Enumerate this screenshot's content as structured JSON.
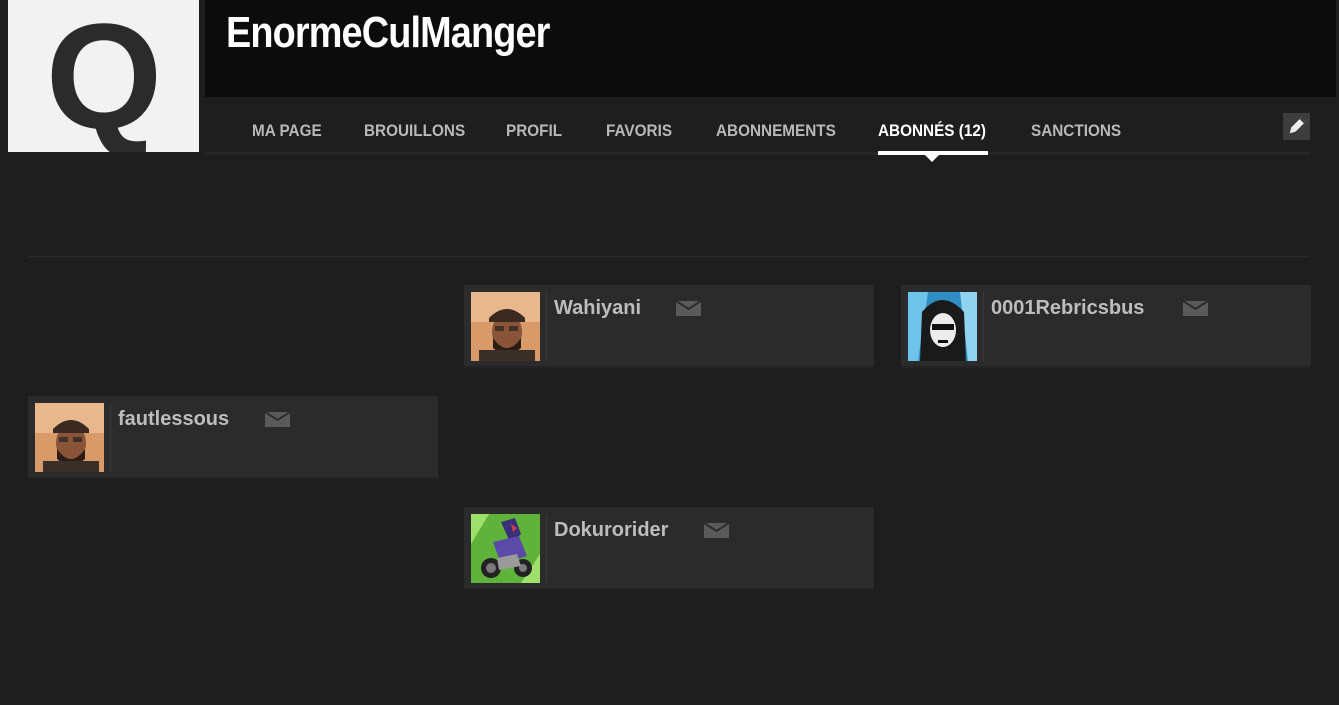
{
  "profile": {
    "username": "EnormeCulManger",
    "avatar_letter": "Q"
  },
  "nav": {
    "items": [
      {
        "label": "MA PAGE",
        "active": false
      },
      {
        "label": "BROUILLONS",
        "active": false
      },
      {
        "label": "PROFIL",
        "active": false
      },
      {
        "label": "FAVORIS",
        "active": false
      },
      {
        "label": "ABONNEMENTS",
        "active": false
      },
      {
        "label": "ABONNÉS (12)",
        "active": true
      },
      {
        "label": "SANCTIONS",
        "active": false
      }
    ],
    "edit_icon": "pencil-icon"
  },
  "subscribers": [
    {
      "name": "Wahiyani",
      "avatar": "man-cap-avatar",
      "mail_icon": "envelope-icon"
    },
    {
      "name": "0001Rebricsbus",
      "avatar": "hooded-skull-avatar",
      "mail_icon": "envelope-icon"
    },
    {
      "name": "fautlessous",
      "avatar": "man-cap-avatar",
      "mail_icon": "envelope-icon"
    },
    {
      "name": "Dokurorider",
      "avatar": "rider-green-avatar",
      "mail_icon": "envelope-icon"
    }
  ],
  "colors": {
    "background": "#1e1e1e",
    "header": "#0c0c0c",
    "card": "#2b2b2b",
    "active_tab": "#ffffff",
    "inactive_tab": "#b8b8b8"
  }
}
